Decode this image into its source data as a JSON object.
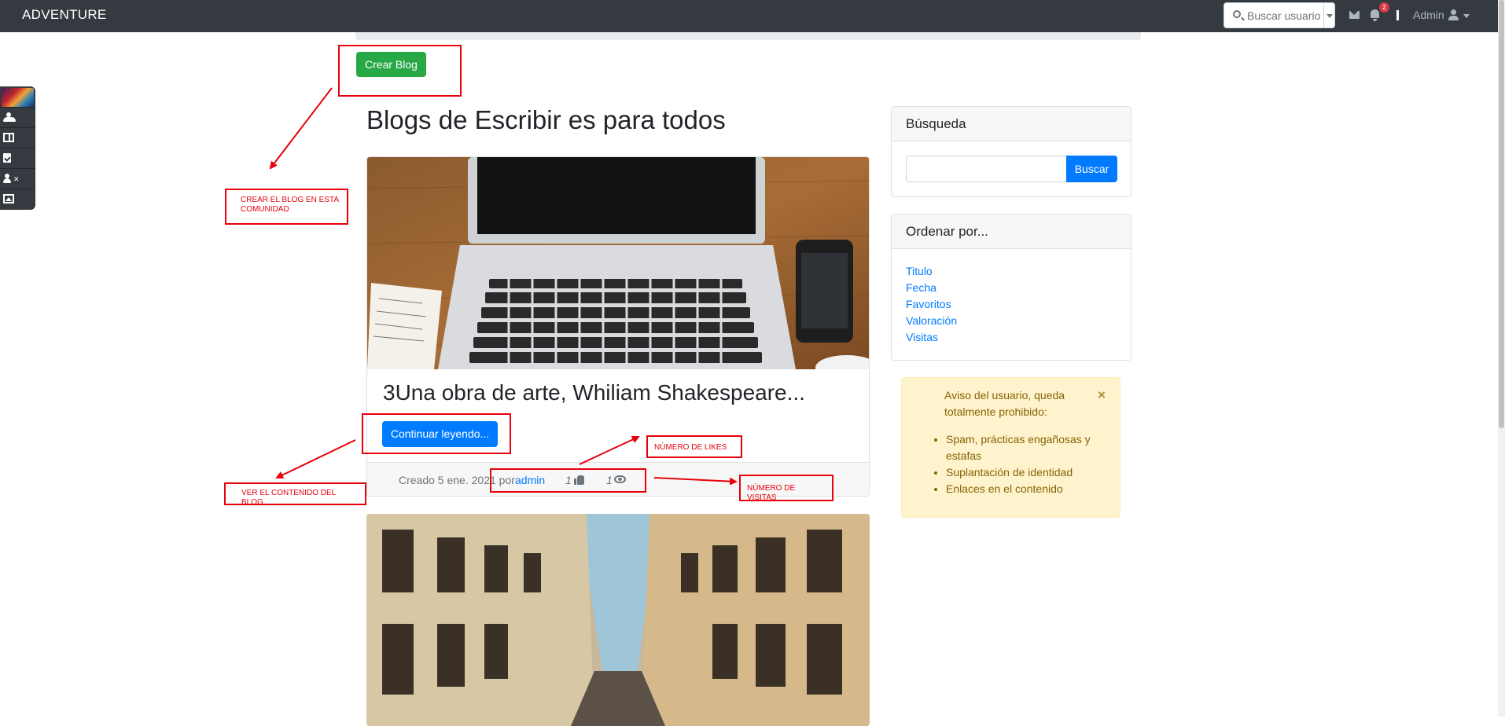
{
  "navbar": {
    "brand": "ADVENTURE",
    "search_placeholder": "Buscar usuario",
    "notifications_count": "2",
    "user_name": "Admin",
    "icons": [
      "envelope-icon",
      "bell-icon",
      "user-icon",
      "search-icon"
    ]
  },
  "actions": {
    "create_blog_label": "Crear Blog"
  },
  "page": {
    "title": "Blogs de Escribir es para todos"
  },
  "blog_posts": [
    {
      "title": "3Una obra de arte, Whiliam Shakespeare...",
      "read_more_label": "Continuar leyendo...",
      "created_prefix": "Creado 5 ene. 2021 por",
      "author": "admin",
      "likes": "1",
      "views": "1",
      "image": "laptop-on-wooden-desk"
    },
    {
      "image": "narrow-street-with-balconies"
    }
  ],
  "sidebar": {
    "search": {
      "header": "Búsqueda",
      "button_label": "Buscar",
      "value": ""
    },
    "order": {
      "header": "Ordenar por...",
      "links": [
        "Titulo",
        "Fecha",
        "Favoritos",
        "Valoración",
        "Visitas"
      ]
    },
    "notice": {
      "text": "Aviso del usuario, queda totalmente prohibido:",
      "close_label": "×",
      "items": [
        "Spam, prácticas engañosas y estafas",
        "Suplantación de identidad",
        "Enlaces en el contenido"
      ]
    }
  },
  "left_toolbar": {
    "icons": [
      "community-image-icon",
      "users-icon",
      "book-icon",
      "clipboard-check-icon",
      "user-times-icon",
      "images-icon"
    ]
  },
  "annotations": {
    "create_blog": "CREAR EL BLOG EN ESTA COMUNIDAD",
    "view_content": "VER EL CONTENIDO DEL BLOG",
    "likes": "NÚMERO DE LIKES",
    "visits": "NÚMERO DE VISITAS",
    "color": "#e8000b"
  },
  "colors": {
    "navbar": "#343a40",
    "primary": "#007bff",
    "success": "#28a745",
    "warning_bg": "#fff3cd",
    "warning_text": "#856404"
  }
}
